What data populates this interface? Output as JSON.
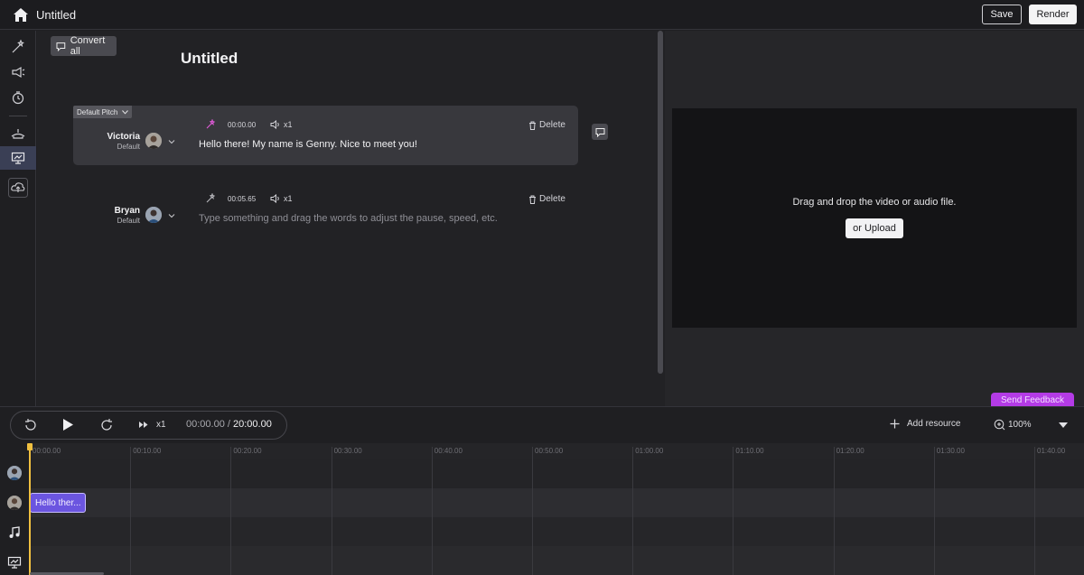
{
  "header": {
    "title": "Untitled",
    "save_label": "Save",
    "render_label": "Render"
  },
  "rail": {
    "icons": [
      "magic-wand-icon",
      "megaphone-icon",
      "timer-icon",
      "voice-icon",
      "presentation-icon",
      "cloud-upload-icon"
    ],
    "active_index": 4
  },
  "editor": {
    "convert_all_label": "Convert all",
    "title": "Untitled",
    "pitch_label": "Default Pitch",
    "blocks": [
      {
        "speaker": "Victoria",
        "style": "Default",
        "time": "00:00.00",
        "speed": "x1",
        "delete_label": "Delete",
        "text": "Hello there! My name is Genny. Nice to meet you!"
      },
      {
        "speaker": "Bryan",
        "style": "Default",
        "time": "00:05.65",
        "speed": "x1",
        "delete_label": "Delete",
        "placeholder": "Type something and drag the words to adjust the pause, speed, etc."
      }
    ]
  },
  "preview": {
    "drop_text": "Drag and drop the video or audio file.",
    "upload_label": "or Upload",
    "feedback_label": "Send Feedback"
  },
  "transport": {
    "speed": "x1",
    "current_time": "00:00.00",
    "separator": "/",
    "total_time": "20:00.00",
    "add_resource_label": "Add resource",
    "zoom": "100%"
  },
  "timeline": {
    "ruler": [
      "00:00.00",
      "00:10.00",
      "00:20.00",
      "00:30.00",
      "00:40.00",
      "00:50.00",
      "01:00.00",
      "01:10.00",
      "01:20.00",
      "01:30.00",
      "01:40.00"
    ],
    "clip_label": "Hello ther...",
    "tracks": [
      "avatar-bryan",
      "avatar-victoria",
      "music-icon",
      "presentation-icon"
    ]
  },
  "colors": {
    "accent": "#6b55e0",
    "feedback": "#b43be6",
    "playhead": "#f0c040"
  }
}
